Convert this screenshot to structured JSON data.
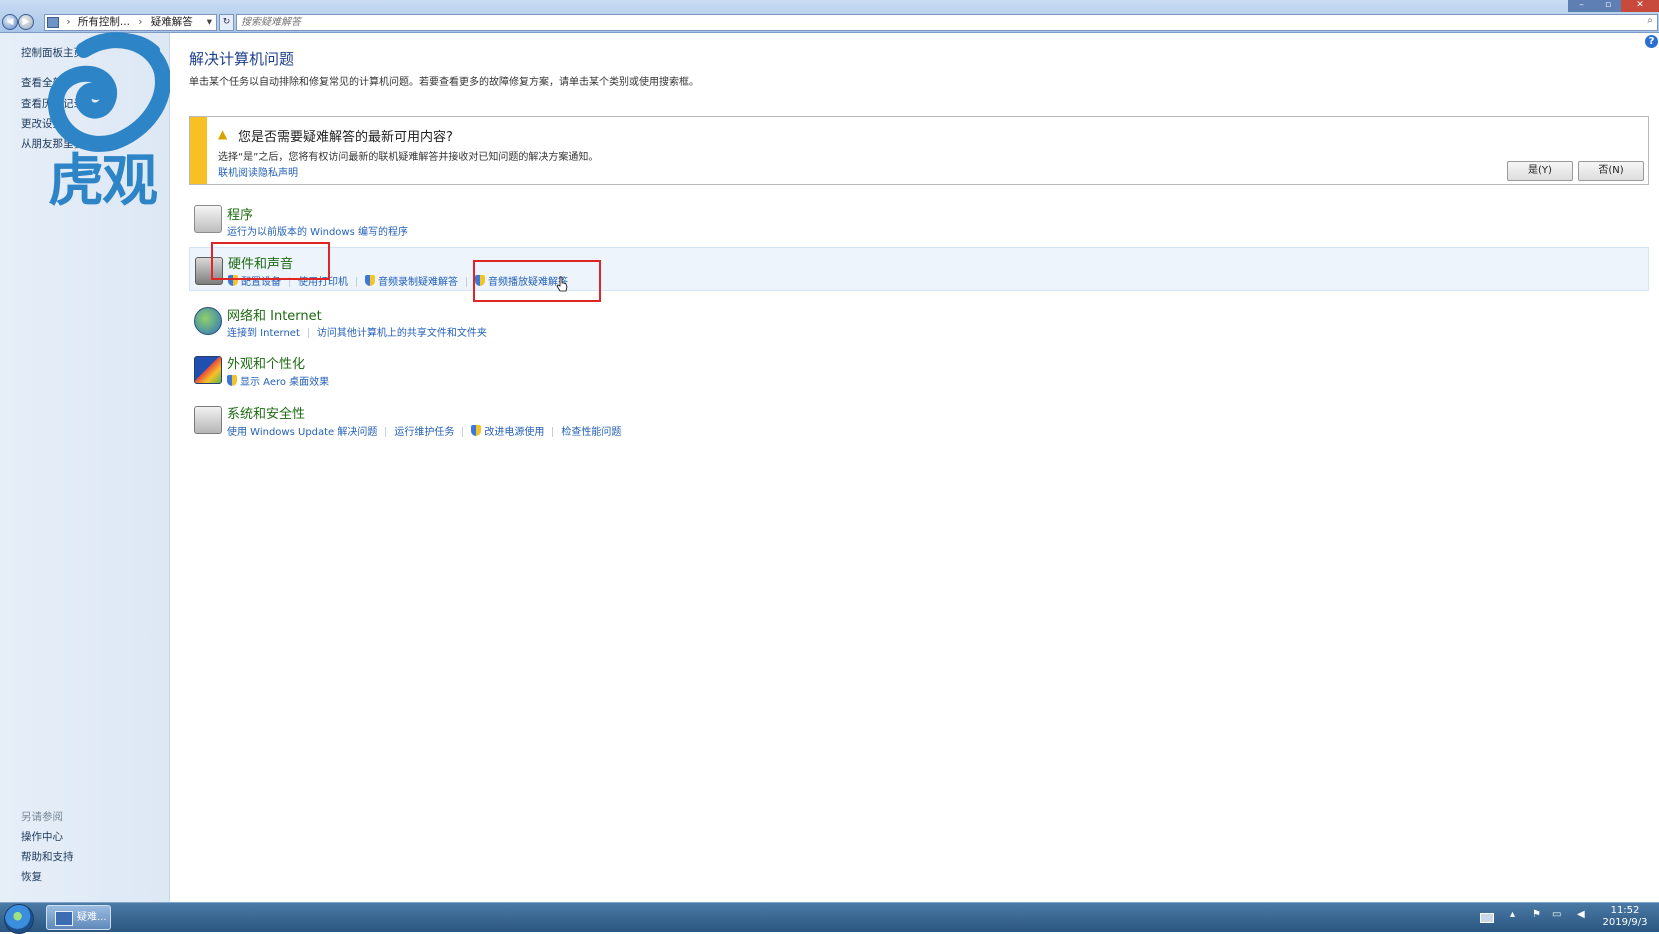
{
  "address": {
    "crumbs": [
      "所有控制...",
      "疑难解答"
    ],
    "search_placeholder": "搜索疑难解答"
  },
  "sidebar": {
    "links": [
      "控制面板主页",
      "查看全部",
      "查看历史记录",
      "更改设置",
      "从朋友那里获取帮助"
    ],
    "see_also_header": "另请参阅",
    "see_also": [
      "操作中心",
      "帮助和支持",
      "恢复"
    ]
  },
  "watermark": {
    "text": "虎观"
  },
  "main": {
    "title": "解决计算机问题",
    "description": "单击某个任务以自动排除和修复常见的计算机问题。若要查看更多的故障修复方案，请单击某个类别或使用搜索框。"
  },
  "notice": {
    "title": "您是否需要疑难解答的最新可用内容?",
    "text": "选择“是”之后，您将有权访问最新的联机疑难解答并接收对已知问题的解决方案通知。",
    "privacy_link": "联机阅读隐私声明",
    "yes_label": "是(Y)",
    "no_label": "否(N)"
  },
  "categories": [
    {
      "title": "程序",
      "links": [
        {
          "label": "运行为以前版本的 Windows 编写的程序",
          "shield": false
        }
      ]
    },
    {
      "title": "硬件和声音",
      "links": [
        {
          "label": "配置设备",
          "shield": true
        },
        {
          "label": "使用打印机",
          "shield": false
        },
        {
          "label": "音频录制疑难解答",
          "shield": true
        },
        {
          "label": "音频播放疑难解答",
          "shield": true
        }
      ]
    },
    {
      "title": "网络和 Internet",
      "links": [
        {
          "label": "连接到 Internet",
          "shield": false
        },
        {
          "label": "访问其他计算机上的共享文件和文件夹",
          "shield": false
        }
      ]
    },
    {
      "title": "外观和个性化",
      "links": [
        {
          "label": "显示 Aero 桌面效果",
          "shield": true
        }
      ]
    },
    {
      "title": "系统和安全性",
      "links": [
        {
          "label": "使用 Windows Update 解决问题",
          "shield": false
        },
        {
          "label": "运行维护任务",
          "shield": false
        },
        {
          "label": "改进电源使用",
          "shield": true
        },
        {
          "label": "检查性能问题",
          "shield": false
        }
      ]
    }
  ],
  "taskbar": {
    "task_label": "疑难...",
    "time": "11:52",
    "date": "2019/9/3"
  },
  "colors": {
    "link": "#2461b7",
    "category_title": "#1d6b12",
    "notice_accent": "#f7c023",
    "highlight_box": "#e02525"
  }
}
